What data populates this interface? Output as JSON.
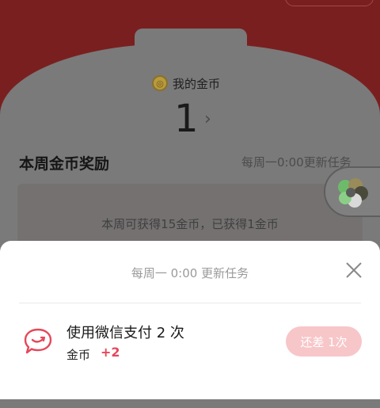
{
  "coins": {
    "label": "我的金币",
    "count": "1",
    "arrow": "›"
  },
  "weekly": {
    "title": "本周金币奖励",
    "update_text": "每周一0:00更新任务",
    "summary": "本周可获得15金币，已获得1金币"
  },
  "sheet": {
    "title": "每周一 0:00 更新任务",
    "tasks": [
      {
        "title": "使用微信支付 2 次",
        "reward_label": "金币",
        "reward_value": "+2",
        "button_label": "还差 1次",
        "icon": "chat-bubble-icon"
      }
    ]
  },
  "colors": {
    "header_red": "#7a1f1f",
    "accent_red": "#e5485a",
    "button_pink": "#f7c6c9"
  }
}
